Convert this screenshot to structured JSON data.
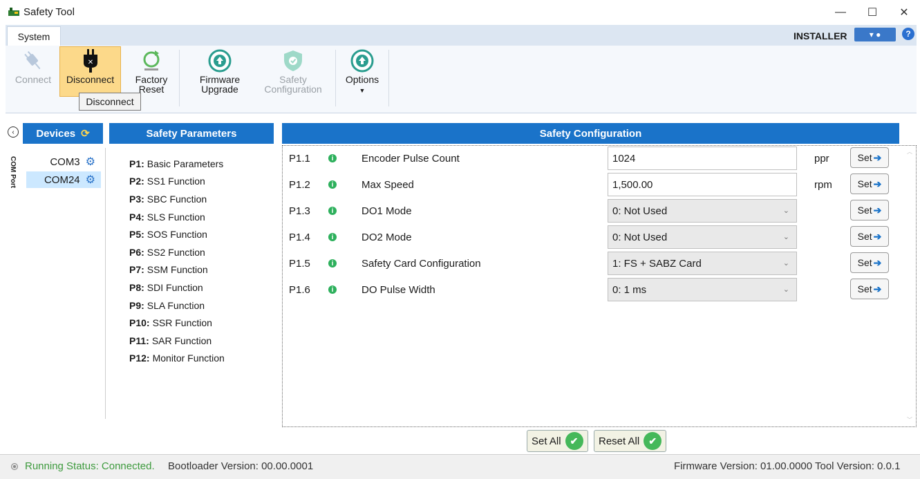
{
  "window": {
    "title": "Safety Tool"
  },
  "ribbon": {
    "tab": "System",
    "role": "INSTALLER",
    "buttons": {
      "connect": "Connect",
      "disconnect": "Disconnect",
      "factory_reset_1": "Factory",
      "factory_reset_2": "Reset",
      "firmware_1": "Firmware",
      "firmware_2": "Upgrade",
      "safety_1": "Safety",
      "safety_2": "Configuration",
      "options": "Options"
    },
    "tooltip": "Disconnect"
  },
  "devices": {
    "header": "Devices",
    "com_port_label": "COM Port",
    "items": [
      "COM3",
      "COM24"
    ]
  },
  "parameters": {
    "header": "Safety Parameters",
    "items": [
      {
        "id": "P1:",
        "name": "Basic Parameters"
      },
      {
        "id": "P2:",
        "name": "SS1 Function"
      },
      {
        "id": "P3:",
        "name": "SBC Function"
      },
      {
        "id": "P4:",
        "name": "SLS Function"
      },
      {
        "id": "P5:",
        "name": "SOS Function"
      },
      {
        "id": "P6:",
        "name": "SS2 Function"
      },
      {
        "id": "P7:",
        "name": "SSM Function"
      },
      {
        "id": "P8:",
        "name": "SDI Function"
      },
      {
        "id": "P9:",
        "name": "SLA Function"
      },
      {
        "id": "P10:",
        "name": "SSR Function"
      },
      {
        "id": "P11:",
        "name": "SAR Function"
      },
      {
        "id": "P12:",
        "name": "Monitor Function"
      }
    ]
  },
  "config": {
    "header": "Safety Configuration",
    "set_label": "Set",
    "rows": [
      {
        "id": "P1.1",
        "label": "Encoder Pulse Count",
        "value": "1024",
        "unit": "ppr",
        "kind": "input"
      },
      {
        "id": "P1.2",
        "label": "Max Speed",
        "value": "1,500.00",
        "unit": "rpm",
        "kind": "input"
      },
      {
        "id": "P1.3",
        "label": "DO1 Mode",
        "value": "0: Not Used",
        "unit": "",
        "kind": "select"
      },
      {
        "id": "P1.4",
        "label": "DO2 Mode",
        "value": "0: Not Used",
        "unit": "",
        "kind": "select"
      },
      {
        "id": "P1.5",
        "label": "Safety Card Configuration",
        "value": "1: FS + SABZ Card",
        "unit": "",
        "kind": "select"
      },
      {
        "id": "P1.6",
        "label": "DO Pulse Width",
        "value": "0: 1 ms",
        "unit": "",
        "kind": "select"
      }
    ],
    "set_all": "Set All",
    "reset_all": "Reset All"
  },
  "status": {
    "running": "Running Status: Connected.",
    "bootloader": "Bootloader Version: 00.00.0001",
    "firmware_tool": "Firmware Version: 01.00.0000 Tool Version: 0.0.1"
  }
}
